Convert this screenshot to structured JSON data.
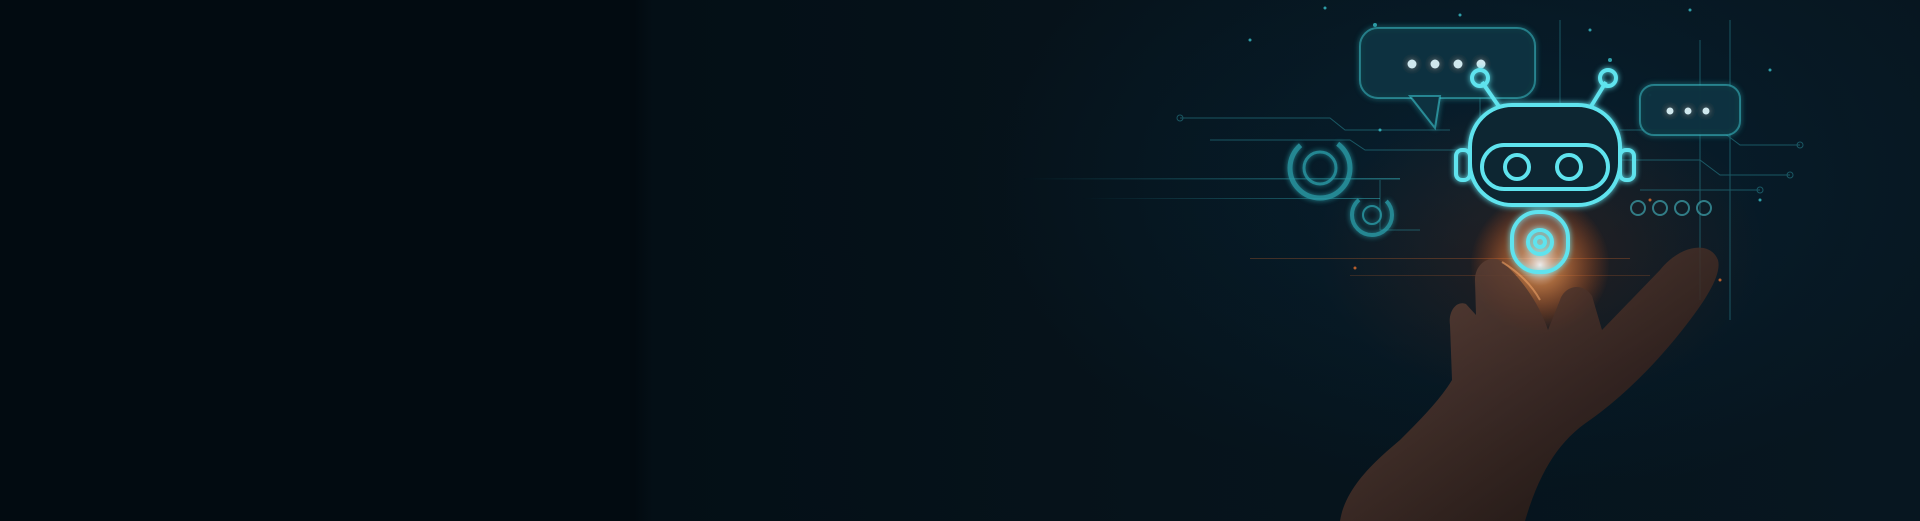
{
  "banner": {
    "description_visible_text": "",
    "colors": {
      "background": "#020a10",
      "glow_cyan": "#3fd6e0",
      "glow_orange": "#ff7a30",
      "hand": "#5a3a30"
    },
    "icons": [
      "robot-icon",
      "chat-bubble-icon",
      "target-ring-icon",
      "hand-image"
    ]
  }
}
